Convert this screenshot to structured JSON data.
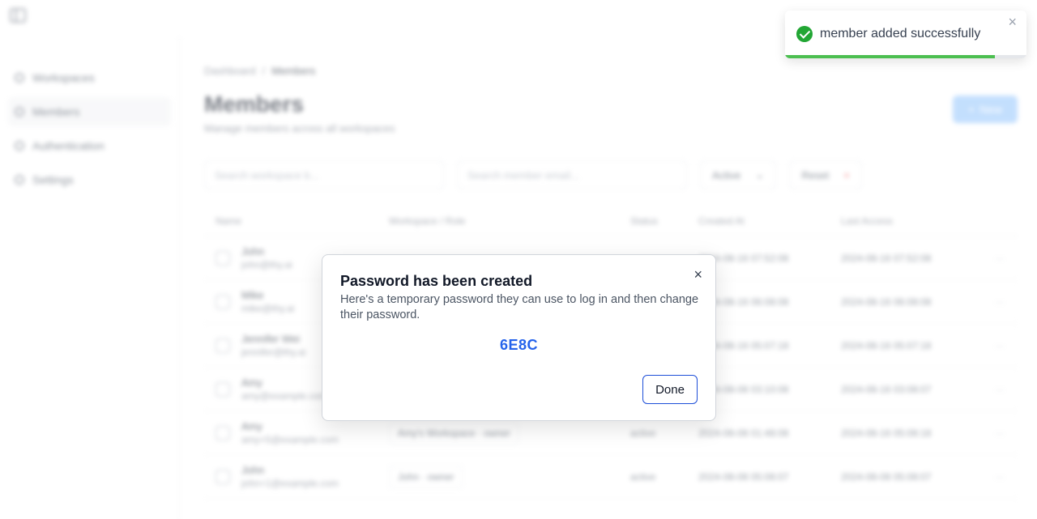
{
  "sidebar": {
    "items": [
      {
        "label": "Workspaces",
        "icon": "grid-icon"
      },
      {
        "label": "Members",
        "icon": "user-icon"
      },
      {
        "label": "Authentication",
        "icon": "lock-icon"
      },
      {
        "label": "Settings",
        "icon": "gear-icon"
      }
    ]
  },
  "header": {
    "breadcrumb": [
      "Dashboard",
      "/",
      "Members"
    ],
    "title": "Members",
    "subtitle": "Manage members across all workspaces",
    "new_button_label": "New"
  },
  "filters": {
    "workspace_placeholder": "Search workspace b...",
    "member_placeholder": "Search member email...",
    "status_label": "Active",
    "reset_label": "Reset"
  },
  "table": {
    "columns": [
      "Name",
      "Workspace / Role",
      "Status",
      "Created At",
      "Last Access"
    ],
    "rows": [
      {
        "name": "John",
        "email": "john@thy.ai",
        "workspace": "",
        "status": "",
        "created": "2024-08-16 07:52:08",
        "access": "2024-08-16 07:52:08"
      },
      {
        "name": "Mike",
        "email": "mike@thy.ai",
        "workspace": "",
        "status": "",
        "created": "2024-08-16 06:08:08",
        "access": "2024-08-16 06:08:08"
      },
      {
        "name": "Jennifer Wei",
        "email": "jennifer@thy.ai",
        "workspace": "",
        "status": "",
        "created": "2024-08-16 05:07:18",
        "access": "2024-08-16 05:07:18"
      },
      {
        "name": "Amy",
        "email": "amy@example.com",
        "workspace": "",
        "status": "",
        "created": "2024-08-08 03:10:08",
        "access": "2024-08-16 03:08:07"
      },
      {
        "name": "Amy",
        "email": "amy+5@example.com",
        "workspace": "Amy's Workspace · owner",
        "status": "active",
        "created": "2024-08-08 01:48:08",
        "access": "2024-08-16 05:08:18"
      },
      {
        "name": "John",
        "email": "john+1@example.com",
        "workspace": "John · owner",
        "status": "active",
        "created": "2024-08-08 05:08:07",
        "access": "2024-08-08 05:08:07"
      }
    ]
  },
  "toast": {
    "message": "member added successfully",
    "close_glyph": "×",
    "progress": 0.87,
    "accent": "#22a634"
  },
  "modal": {
    "title": "Password has been created",
    "description": "Here's a temporary password they can use to log in and then change their password.",
    "password": "6E8C",
    "done_label": "Done",
    "close_glyph": "×",
    "accent": "#2563eb"
  }
}
